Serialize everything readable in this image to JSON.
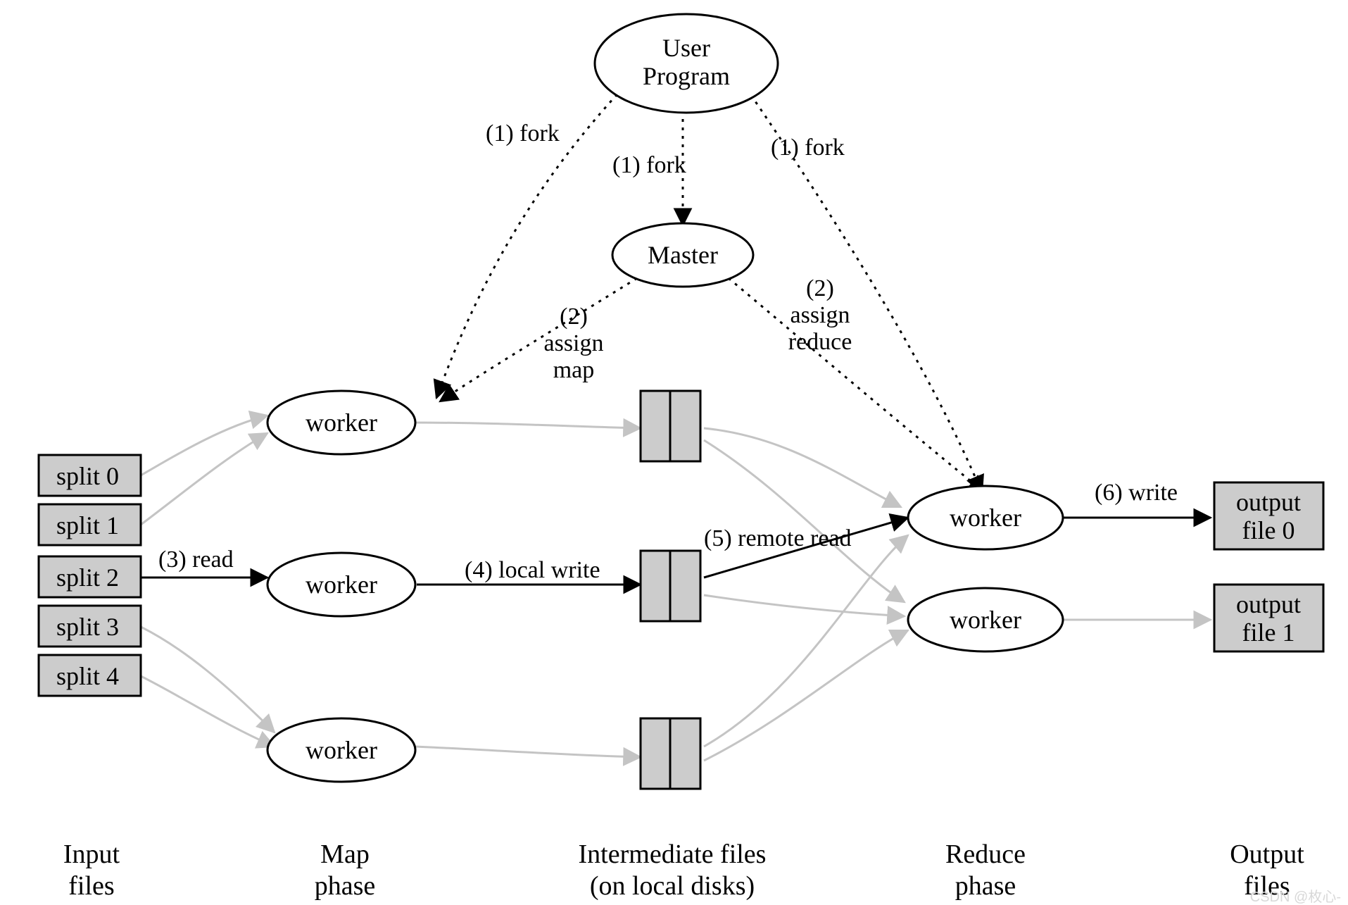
{
  "nodes": {
    "user_program": {
      "line1": "User",
      "line2": "Program"
    },
    "master": "Master",
    "map_worker_0": "worker",
    "map_worker_1": "worker",
    "map_worker_2": "worker",
    "reduce_worker_0": "worker",
    "reduce_worker_1": "worker",
    "split_0": "split 0",
    "split_1": "split 1",
    "split_2": "split 2",
    "split_3": "split 3",
    "split_4": "split 4",
    "output_0": {
      "line1": "output",
      "line2": "file 0"
    },
    "output_1": {
      "line1": "output",
      "line2": "file 1"
    }
  },
  "edges": {
    "fork_left": "(1) fork",
    "fork_mid": "(1) fork",
    "fork_right": "(1) fork",
    "assign_map": {
      "line1": "(2)",
      "line2": "assign",
      "line3": "map"
    },
    "assign_reduce": {
      "line1": "(2)",
      "line2": "assign",
      "line3": "reduce"
    },
    "read": "(3) read",
    "local_write": "(4) local write",
    "remote_read": "(5) remote read",
    "write": "(6) write"
  },
  "captions": {
    "input": {
      "line1": "Input",
      "line2": "files"
    },
    "map": {
      "line1": "Map",
      "line2": "phase"
    },
    "intermediate": {
      "line1": "Intermediate files",
      "line2": "(on local disks)"
    },
    "reduce": {
      "line1": "Reduce",
      "line2": "phase"
    },
    "output": {
      "line1": "Output",
      "line2": "files"
    }
  },
  "watermark": "CSDN @枚心-",
  "colors": {
    "box_fill": "#cccccc",
    "stroke": "#000000",
    "light": "#c4c4c4"
  }
}
